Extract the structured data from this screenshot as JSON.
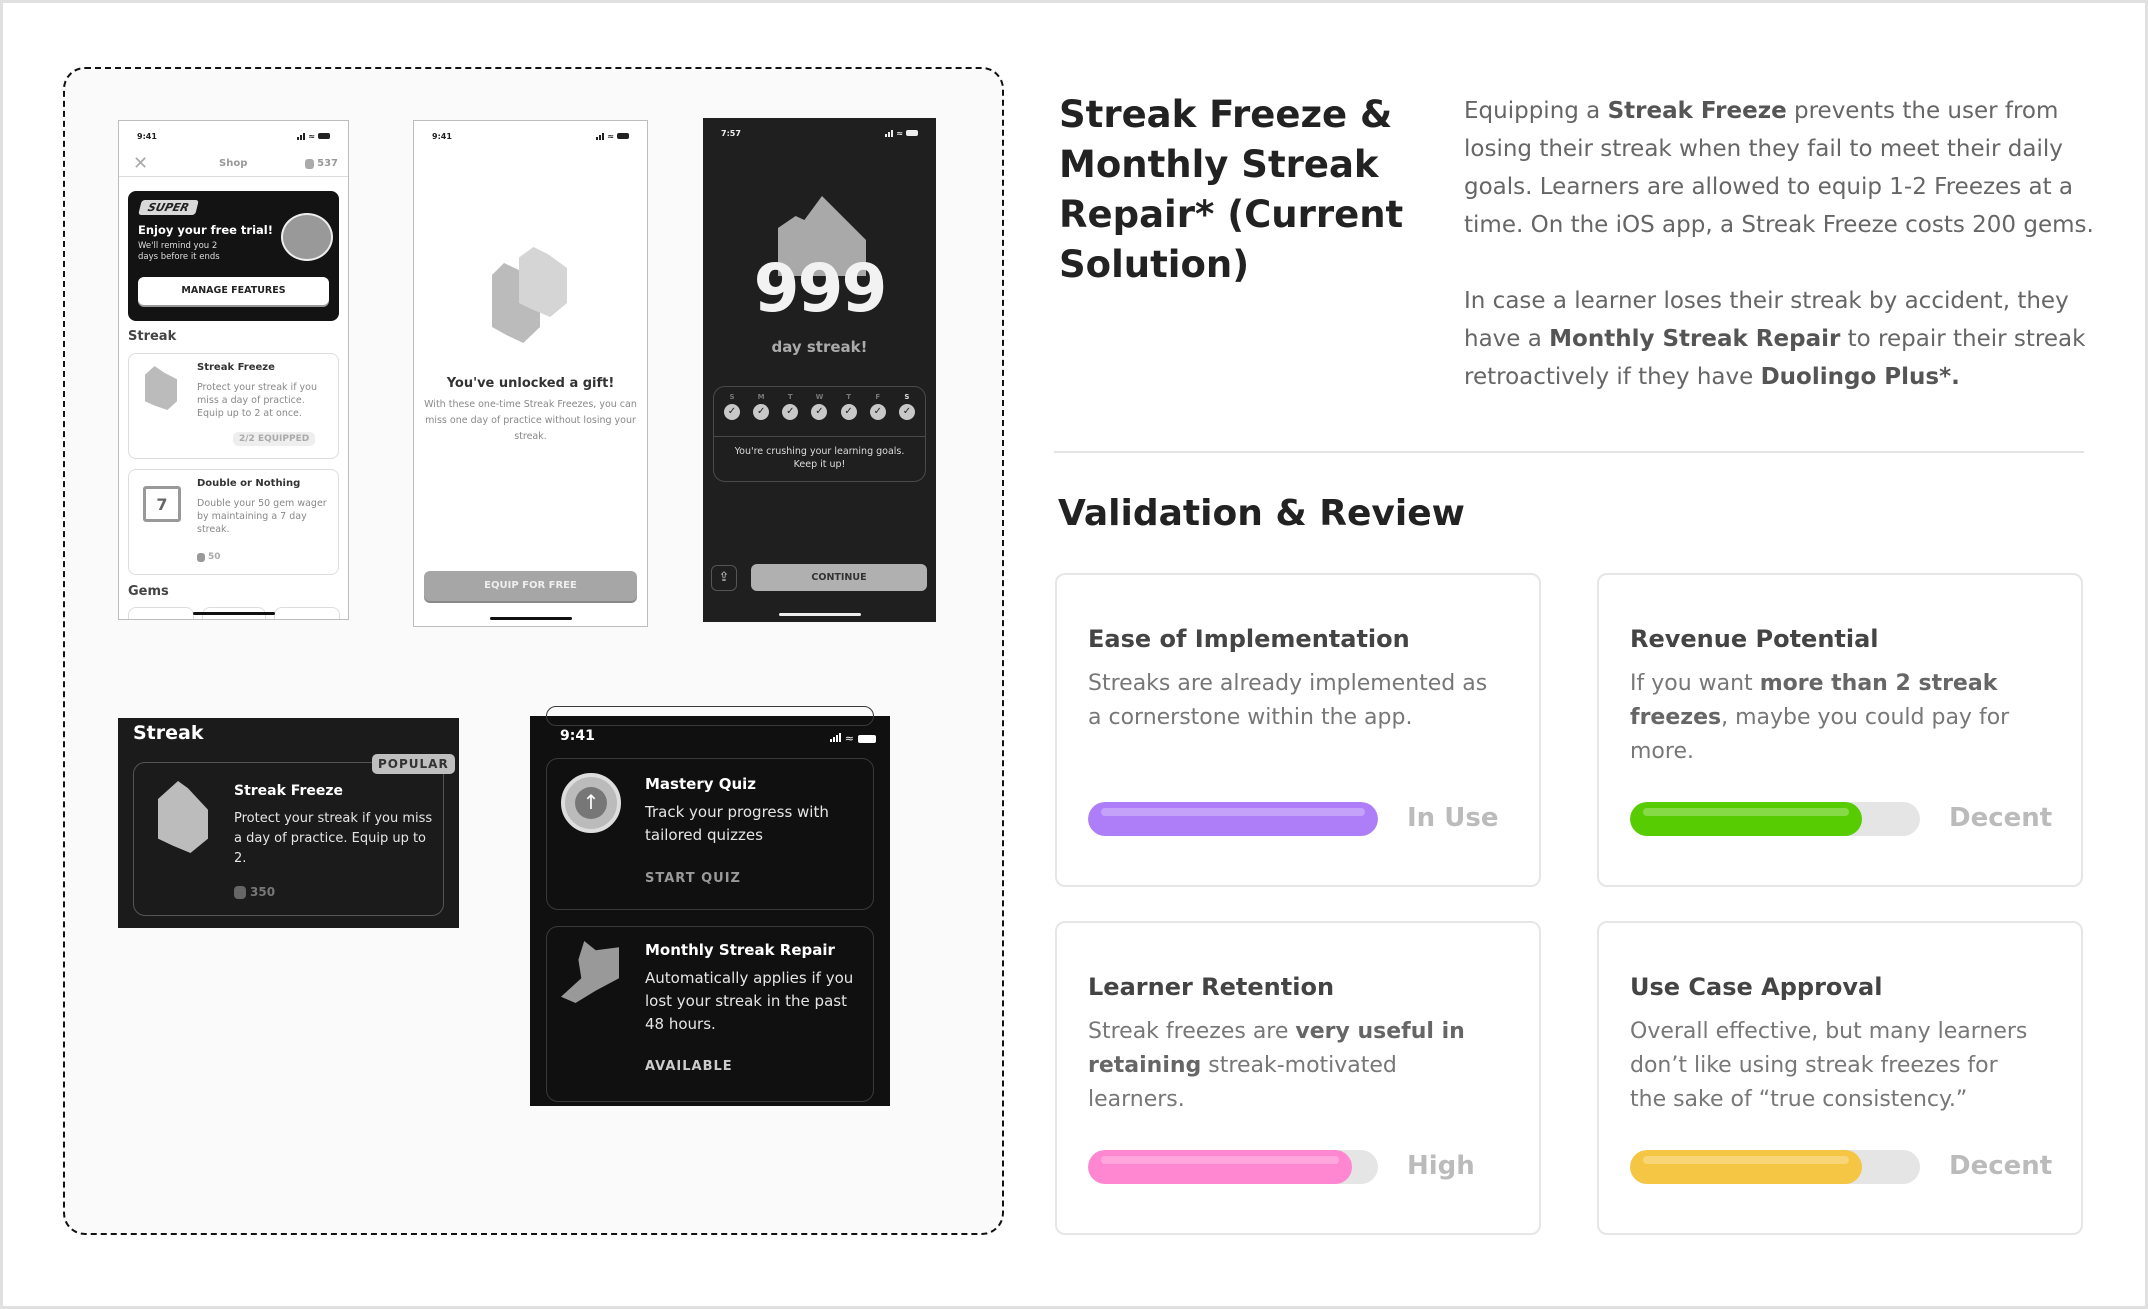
{
  "left_panel": {
    "phone_shop": {
      "time": "9:41",
      "nav_title": "Shop",
      "gem_count": "537",
      "super_badge": "SUPER",
      "promo_title": "Enjoy your free trial!",
      "promo_text": "We'll remind you 2 days before it ends",
      "promo_button": "MANAGE FEATURES",
      "section_streak": "Streak",
      "items": [
        {
          "title": "Streak Freeze",
          "desc": "Protect your streak if you miss a day of practice. Equip up to 2 at once.",
          "status": "2/2 EQUIPPED"
        },
        {
          "title": "Double or Nothing",
          "desc": "Double your 50 gem wager by maintaining a 7 day streak.",
          "price": "50",
          "calendar_number": "7"
        }
      ],
      "section_gems": "Gems"
    },
    "phone_gift": {
      "time": "9:41",
      "title": "You've unlocked a gift!",
      "text": "With these one-time Streak Freezes, you can miss one day of practice without losing your streak.",
      "button": "EQUIP FOR FREE"
    },
    "phone_streak": {
      "time": "7:57",
      "streak_number": "999",
      "streak_label": "day streak!",
      "days": [
        "S",
        "M",
        "T",
        "W",
        "T",
        "F",
        "S"
      ],
      "message": "You're crushing your learning goals. Keep it up!",
      "button": "CONTINUE"
    },
    "dark_streak_card": {
      "section": "Streak",
      "badge": "POPULAR",
      "title": "Streak Freeze",
      "desc": "Protect your streak if you miss a day of practice. Equip up to 2.",
      "price": "350"
    },
    "dark_list": {
      "time": "9:41",
      "items": [
        {
          "title": "Mastery Quiz",
          "desc": "Track your progress with tailored quizzes",
          "action": "START QUIZ"
        },
        {
          "title": "Monthly Streak Repair",
          "desc": "Automatically applies if you lost your streak in the past 48 hours.",
          "action": "AVAILABLE"
        }
      ]
    }
  },
  "header": {
    "title": "Streak Freeze & Monthly Streak Repair* (Current Solution)",
    "p1": [
      {
        "t": "Equipping a "
      },
      {
        "t": "Streak Freeze",
        "b": true
      },
      {
        "t": " prevents the user from losing their streak when they fail to meet their daily goals. Learners are allowed to equip 1-2 Freezes at a time. On the iOS app, a Streak Freeze costs 200 gems."
      }
    ],
    "p2": [
      {
        "t": "In case a learner loses their streak by accident, they have a "
      },
      {
        "t": "Monthly Streak Repair",
        "b": true
      },
      {
        "t": " to repair their streak retroactively if they have "
      },
      {
        "t": "Duolingo Plus*.",
        "b": true
      }
    ]
  },
  "validation": {
    "heading": "Validation & Review",
    "cards": [
      {
        "title": "Ease of Implementation",
        "desc": [
          {
            "t": "Streaks are already implemented as a cornerstone within the app."
          }
        ],
        "rating": "In Use",
        "progress": 1.0,
        "color": "#ae7ef9"
      },
      {
        "title": "Revenue Potential",
        "desc": [
          {
            "t": "If you want "
          },
          {
            "t": "more than 2 streak freezes",
            "b": true
          },
          {
            "t": ", maybe you could pay for more."
          }
        ],
        "rating": "Decent",
        "progress": 0.8,
        "color": "#58cc02"
      },
      {
        "title": "Learner Retention",
        "desc": [
          {
            "t": "Streak freezes are "
          },
          {
            "t": "very useful in retaining",
            "b": true
          },
          {
            "t": " streak-motivated learners."
          }
        ],
        "rating": "High",
        "progress": 0.91,
        "color": "#ff86d0"
      },
      {
        "title": "Use Case Approval",
        "desc": [
          {
            "t": "Overall effective, but many learners don’t like using streak freezes for the sake of “true consistency.”"
          }
        ],
        "rating": "Decent",
        "progress": 0.8,
        "color": "#f5c643"
      }
    ]
  }
}
